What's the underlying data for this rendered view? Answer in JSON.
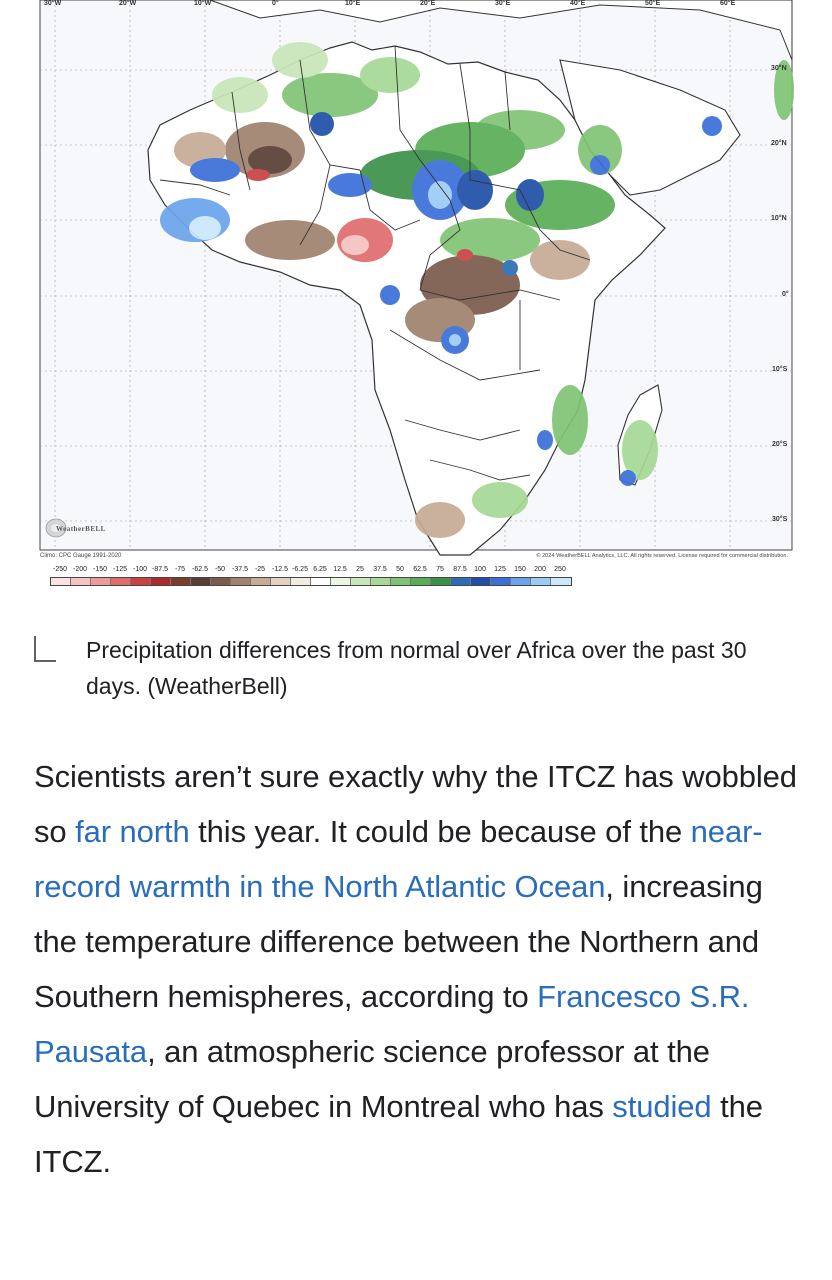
{
  "map": {
    "lat_labels": [
      {
        "label": "30°N"
      },
      {
        "label": "20°N"
      },
      {
        "label": "10°N"
      },
      {
        "label": "0°"
      },
      {
        "label": "10°S"
      },
      {
        "label": "20°S"
      },
      {
        "label": "30°S"
      }
    ],
    "lon_labels": [
      "30°W",
      "20°W",
      "10°W",
      "0°",
      "10°E",
      "20°E",
      "30°E",
      "40°E",
      "50°E",
      "60°E"
    ],
    "climo_label": "Climo: CPC Gauge 1991-2020",
    "copyright": "© 2024 WeatherBELL Analytics, LLC. All rights reserved. License required for commercial distribution.",
    "logo_text": "WeatherBELL",
    "legend": {
      "ticks": [
        "-250",
        "-200",
        "-150",
        "-125",
        "-100",
        "-87.5",
        "-75",
        "-62.5",
        "-50",
        "-37.5",
        "-25",
        "-12.5",
        "-6.25",
        "6.25",
        "12.5",
        "25",
        "37.5",
        "50",
        "62.5",
        "75",
        "87.5",
        "100",
        "125",
        "150",
        "200",
        "250"
      ],
      "colors": [
        "#fbe3e3",
        "#f6c2c2",
        "#ef9a9a",
        "#e06c6c",
        "#c94242",
        "#a92c2c",
        "#7d3b2a",
        "#5a3e35",
        "#7a5b4c",
        "#a0826e",
        "#c6ab95",
        "#e3d2c2",
        "#f2ebe3",
        "#ffffff",
        "#eaf5e3",
        "#c8e6b8",
        "#a6d896",
        "#7fc474",
        "#58ad56",
        "#3c9148",
        "#2c6db3",
        "#1f4fa8",
        "#3a6fd8",
        "#6aa4ec",
        "#9ccaf5",
        "#c9e8fb"
      ]
    }
  },
  "caption": {
    "text": "Precipitation differences from normal over Africa over the past 30 days. (WeatherBell)"
  },
  "article": {
    "p1": "Scientists aren’t sure exactly why the ITCZ has wobbled so ",
    "link1": "far north",
    "p2": " this year. It could be because of the ",
    "link2": "near-record warmth in the North Atlantic Ocean",
    "p3": ", increasing the temperature difference between the Northern and Southern hemispheres, according to ",
    "link3": "Francesco S.R. Pausata",
    "p4": ", an atmospheric science professor at the University of Quebec in Montreal who has ",
    "link4": "studied",
    "p5": " the ITCZ."
  }
}
